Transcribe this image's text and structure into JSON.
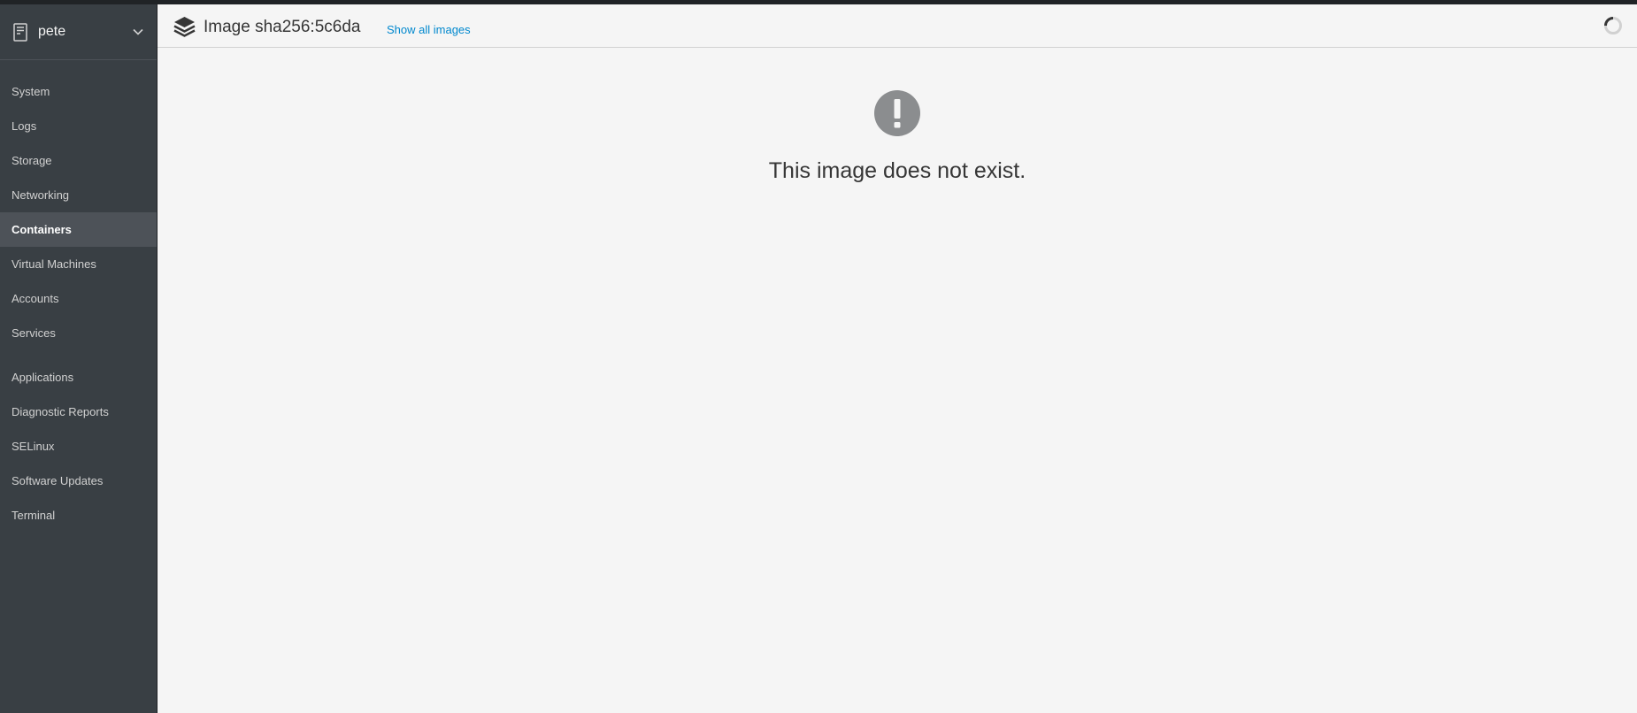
{
  "host": {
    "name": "pete",
    "icon": "server-icon",
    "dropdown_icon": "chevron-down-icon"
  },
  "nav": {
    "items": [
      {
        "label": "System"
      },
      {
        "label": "Logs"
      },
      {
        "label": "Storage"
      },
      {
        "label": "Networking"
      },
      {
        "label": "Containers",
        "active": true
      },
      {
        "label": "Virtual Machines"
      },
      {
        "label": "Accounts"
      },
      {
        "label": "Services"
      },
      {
        "label": "Applications"
      },
      {
        "label": "Diagnostic Reports"
      },
      {
        "label": "SELinux"
      },
      {
        "label": "Software Updates"
      },
      {
        "label": "Terminal"
      }
    ]
  },
  "header": {
    "title": "Image sha256:5c6da",
    "show_all_label": "Show all images",
    "icon": "image-layers-icon"
  },
  "empty_state": {
    "icon": "exclamation-circle-icon",
    "message": "This image does not exist."
  },
  "colors": {
    "sidebar_bg": "#393f44",
    "active_item_bg": "#4d5258",
    "main_bg": "#f5f5f5",
    "link": "#0088ce",
    "alert_icon": "#8b8d8f"
  }
}
